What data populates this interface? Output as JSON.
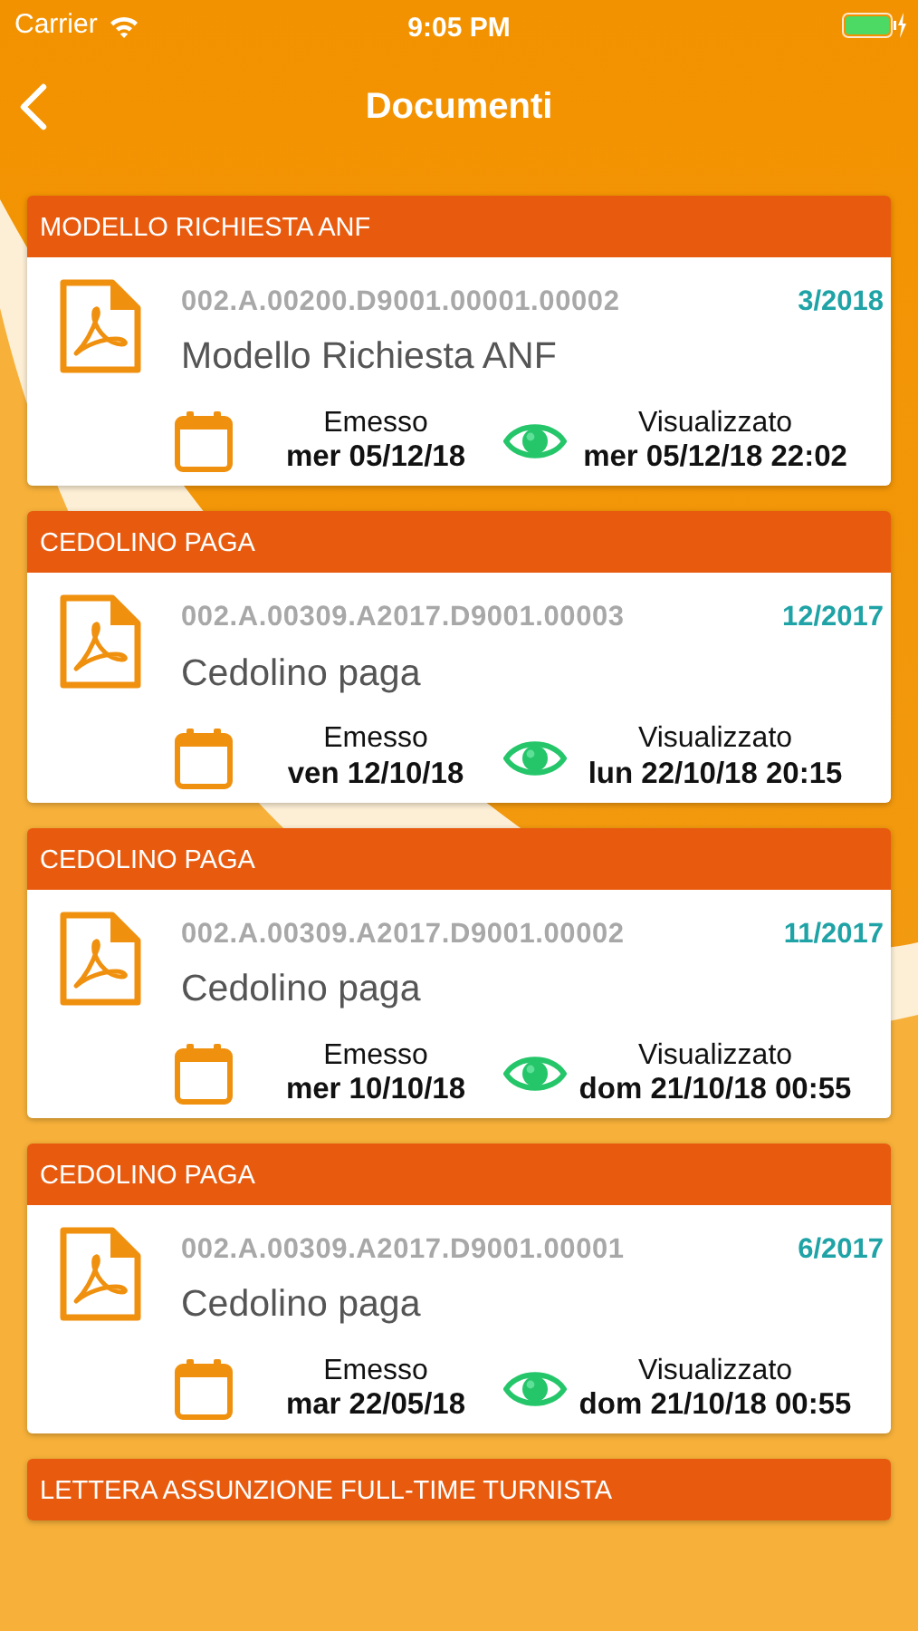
{
  "status_bar": {
    "carrier": "Carrier",
    "time": "9:05 PM"
  },
  "nav": {
    "title": "Documenti"
  },
  "documents": [
    {
      "category": "MODELLO RICHIESTA ANF",
      "code": "002.A.00200.D9001.00001.00002",
      "period": "3/2018",
      "title": "Modello Richiesta ANF",
      "issued_label": "Emesso",
      "issued_date": "mer 05/12/18",
      "viewed_label": "Visualizzato",
      "viewed_date": "mer 05/12/18 22:02"
    },
    {
      "category": "CEDOLINO PAGA",
      "code": "002.A.00309.A2017.D9001.00003",
      "period": "12/2017",
      "title": "Cedolino paga",
      "issued_label": "Emesso",
      "issued_date": "ven 12/10/18",
      "viewed_label": "Visualizzato",
      "viewed_date": "lun 22/10/18 20:15"
    },
    {
      "category": "CEDOLINO PAGA",
      "code": "002.A.00309.A2017.D9001.00002",
      "period": "11/2017",
      "title": "Cedolino paga",
      "issued_label": "Emesso",
      "issued_date": "mer 10/10/18",
      "viewed_label": "Visualizzato",
      "viewed_date": "dom 21/10/18 00:55"
    },
    {
      "category": "CEDOLINO PAGA",
      "code": "002.A.00309.A2017.D9001.00001",
      "period": "6/2017",
      "title": "Cedolino paga",
      "issued_label": "Emesso",
      "issued_date": "mar 22/05/18",
      "viewed_label": "Visualizzato",
      "viewed_date": "dom 21/10/18 00:55"
    },
    {
      "category": "LETTERA ASSUNZIONE FULL-TIME TURNISTA"
    }
  ]
}
